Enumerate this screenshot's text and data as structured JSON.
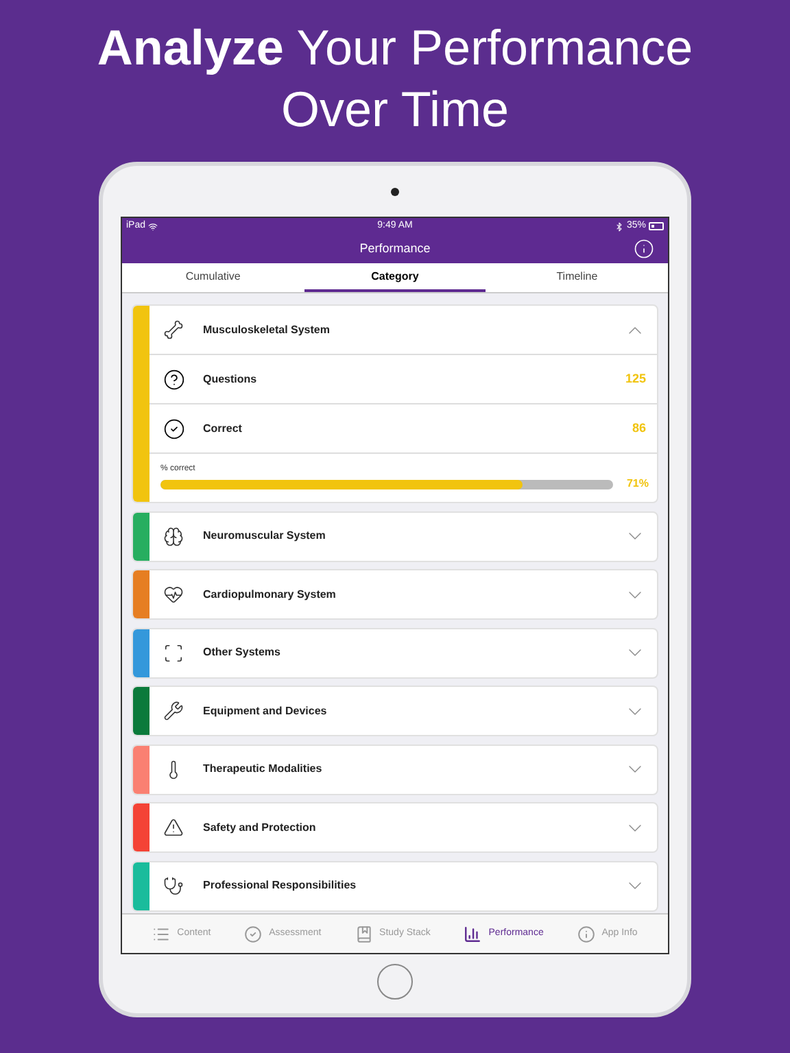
{
  "headline": [
    "**Analyze** Your Performance",
    "Over Time"
  ],
  "status_bar": {
    "carrier": "iPad",
    "time": "9:49 AM",
    "battery": "35%"
  },
  "nav_bar": {
    "title": "Performance"
  },
  "tabs": [
    {
      "label": "Cumulative",
      "selected": false
    },
    {
      "label": "Category",
      "selected": true
    },
    {
      "label": "Timeline",
      "selected": false
    }
  ],
  "categories": [
    {
      "name": "Musculoskeletal System",
      "color": "#f1c40f",
      "expanded": true,
      "stats": [
        {
          "kind": "question",
          "label": "Questions",
          "value": "125"
        },
        {
          "kind": "check",
          "label": "Correct",
          "value": "86"
        }
      ],
      "progress": {
        "label": "% correct",
        "level": 0.8,
        "reading": "71%"
      }
    },
    {
      "name": "Neuromuscular System",
      "color": "#27ae60",
      "expanded": false
    },
    {
      "name": "Cardiopulmonary System",
      "color": "#e67e22",
      "expanded": false
    },
    {
      "name": "Other Systems",
      "color": "#3498db",
      "expanded": false
    },
    {
      "name": "Equipment and Devices",
      "color": "#0b7a3b",
      "expanded": false
    },
    {
      "name": "Therapeutic Modalities",
      "color": "#fa8072",
      "expanded": false
    },
    {
      "name": "Safety and Protection",
      "color": "#f44336",
      "expanded": false
    },
    {
      "name": "Professional Responsibilities",
      "color": "#1abc9c",
      "expanded": false
    }
  ],
  "bottom_tabs": [
    {
      "label": "Content",
      "selected": false
    },
    {
      "label": "Assessment",
      "selected": false
    },
    {
      "label": "Study Stack",
      "selected": false
    },
    {
      "label": "Performance",
      "selected": true
    },
    {
      "label": "App Info",
      "selected": false
    }
  ]
}
